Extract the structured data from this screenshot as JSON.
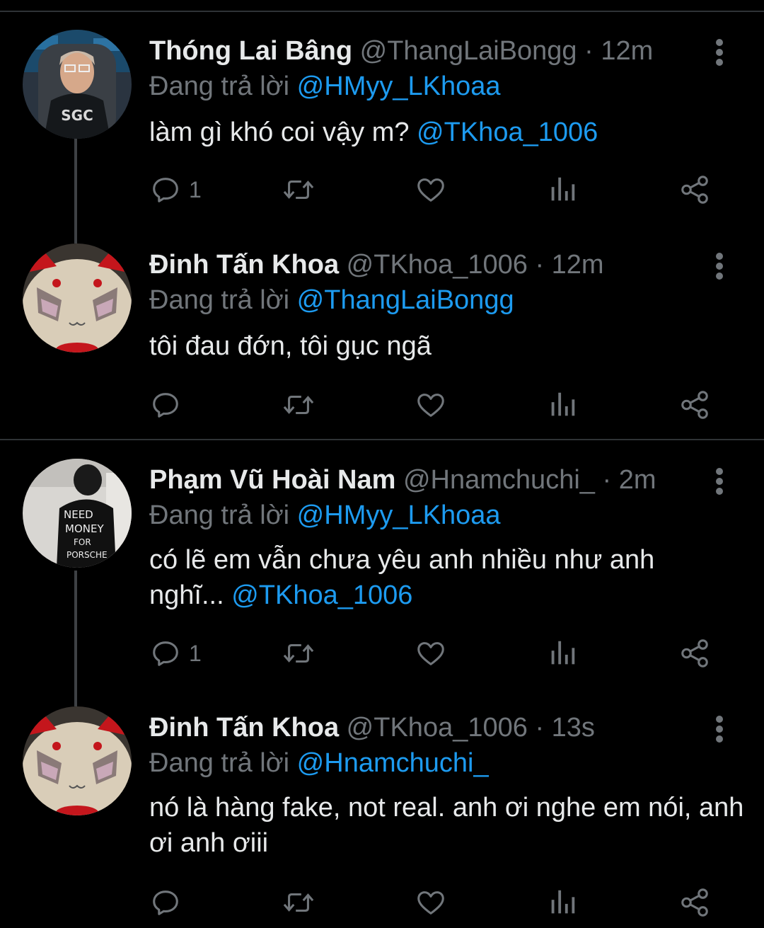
{
  "colors": {
    "background": "#000000",
    "text_primary": "#e7e9ea",
    "text_secondary": "#71767b",
    "accent": "#1d9bf0",
    "divider": "#2f3336"
  },
  "reply_prefix": "Đang trả lời",
  "tweets": [
    {
      "display_name": "Thóng Lai Bâng",
      "handle": "@ThangLaiBongg",
      "time": "12m",
      "reply_to": "@HMyy_LKhoaa",
      "text": "làm gì khó coi vậy m?",
      "text_mention": "@TKhoa_1006",
      "reply_count": "1",
      "avatar": "gamer-avatar-image"
    },
    {
      "display_name": "Đinh Tấn Khoa",
      "handle": "@TKhoa_1006",
      "time": "12m",
      "reply_to": "@ThangLaiBongg",
      "text": "tôi đau đớn, tôi gục ngã",
      "text_mention": "",
      "reply_count": "",
      "avatar": "plush-toy-avatar-image"
    },
    {
      "display_name": "Phạm Vũ Hoài Nam",
      "handle": "@Hnamchuchi_",
      "time": "2m",
      "reply_to": "@HMyy_LKhoaa",
      "text": "có lẽ em vẫn chưa yêu anh nhiều như anh nghĩ...",
      "text_mention": "@TKhoa_1006",
      "reply_count": "1",
      "avatar": "need-money-shirt-avatar-image"
    },
    {
      "display_name": "Đinh Tấn Khoa",
      "handle": "@TKhoa_1006",
      "time": "13s",
      "reply_to": "@Hnamchuchi_",
      "text": "nó là hàng fake, not real. anh ơi nghe em nói, anh ơi anh ơiii",
      "text_mention": "",
      "reply_count": "",
      "avatar": "plush-toy-avatar-image"
    }
  ],
  "icons": {
    "reply": "reply-icon",
    "retweet": "retweet-icon",
    "like": "heart-icon",
    "views": "views-icon",
    "share": "share-icon",
    "more": "more-vertical-icon"
  }
}
